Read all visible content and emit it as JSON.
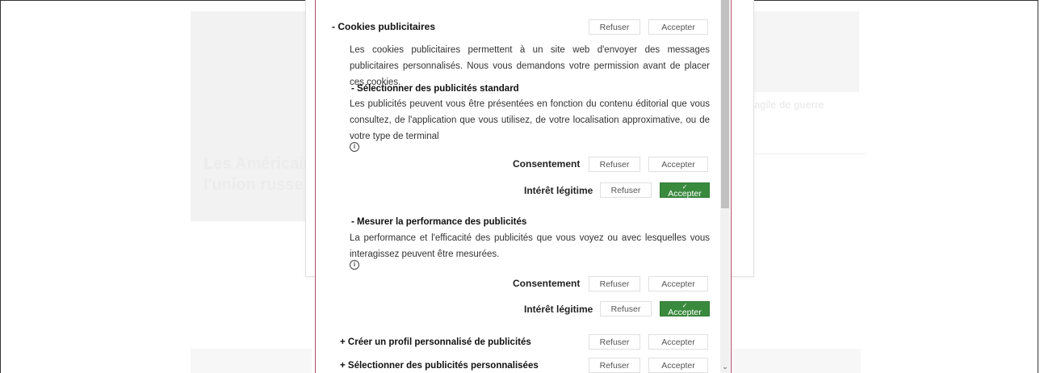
{
  "background": {
    "hero_text_line1": "Les Américains",
    "hero_text_line2": "l'union russe",
    "right_text": "agile de guerre"
  },
  "panel": {
    "section_title": "- Cookies publicitaires",
    "section_desc": "Les cookies publicitaires permettent à un site web d'envoyer des messages publicitaires personnalisés. Nous vous demandons votre permission avant de placer ces cookies.",
    "refuser_label": "Refuser",
    "accepter_label": "Accepter",
    "sub1": {
      "title": "- Sélectionner des publicités standard",
      "desc": "Les publicités peuvent vous être présentées en fonction du contenu éditorial que vous consultez, de l'application que vous utilisez, de votre localisation approximative, ou de votre type de terminal",
      "consent_label": "Consentement",
      "legit_label": "Intérêt légitime"
    },
    "sub2": {
      "title": "- Mesurer la performance des publicités",
      "desc": "La performance et l'efficacité des publicités que vous voyez ou avec lesquelles vous interagissez peuvent être mesurées.",
      "consent_label": "Consentement",
      "legit_label": "Intérêt légitime"
    },
    "sub3": {
      "title": "+ Créer un profil personnalisé de publicités"
    },
    "sub4": {
      "title": "+ Sélectionner des publicités personnalisées"
    },
    "check_glyph": "✓",
    "info_glyph": "i",
    "scroll_glyph": "⌄"
  },
  "colors": {
    "accept_active": "#3a8a3e",
    "panel_border": "#b0506a"
  }
}
